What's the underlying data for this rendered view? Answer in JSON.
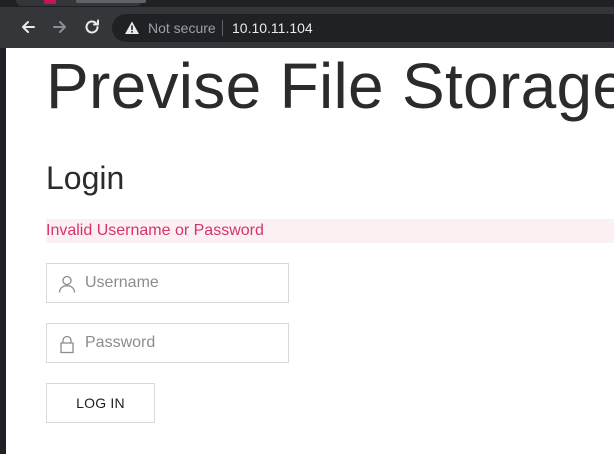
{
  "browser": {
    "security_label": "Not secure",
    "url": "10.10.11.104"
  },
  "page": {
    "site_title": "Previse File Storage",
    "login_heading": "Login",
    "error_message": "Invalid Username or Password",
    "username": {
      "placeholder": "Username",
      "value": ""
    },
    "password": {
      "placeholder": "Password",
      "value": ""
    },
    "login_button_label": "LOG IN"
  },
  "colors": {
    "error_text": "#d6336c",
    "error_background": "#fdf0f2",
    "chrome_toolbar": "#35363a",
    "chrome_tabstrip": "#202124"
  },
  "icons": {
    "back": "back-arrow-icon",
    "forward": "forward-arrow-icon",
    "reload": "reload-icon",
    "security": "warning-triangle-icon",
    "username": "user-icon",
    "password": "lock-icon"
  }
}
